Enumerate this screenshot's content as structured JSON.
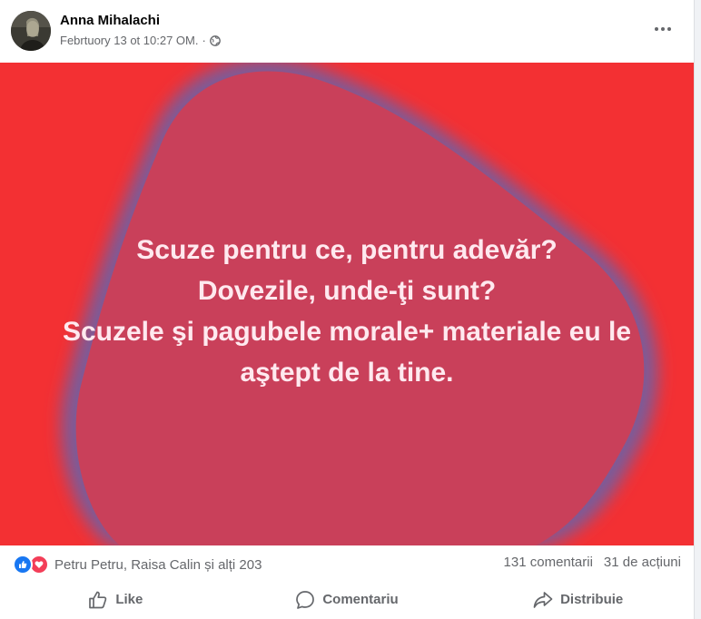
{
  "post": {
    "author": "Anna Mihalachi",
    "timestamp": "Febrtuory 13 ot 10:27 OM.",
    "audience_separator": "·",
    "audience_icon": "globe-icon",
    "more_icon": "more-options-icon"
  },
  "content": {
    "lines": [
      "Scuze pentru ce, pentru adevăr?",
      "Dovezile, unde-ţi sunt?",
      "Scuzele şi pagubele morale+ materiale eu le",
      "aştept de la tine."
    ],
    "background_color": "#f33033",
    "blob_color": "#c9405a",
    "text_color": "#ffe9ef"
  },
  "reactions": {
    "types": [
      "like",
      "love"
    ],
    "summary": "Petru Petru, Raisa Calin și alți 203",
    "comments": "131 comentarii",
    "shares": "31 de acțiuni"
  },
  "actions": {
    "like": "Like",
    "comment": "Comentariu",
    "share": "Distribuie"
  }
}
